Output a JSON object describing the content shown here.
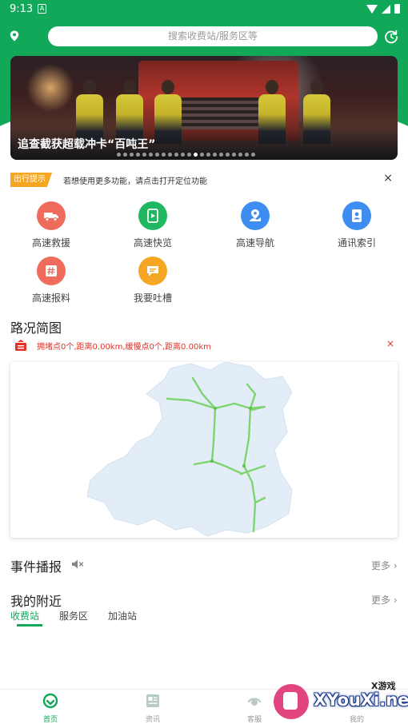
{
  "status_bar": {
    "time": "9:13",
    "notification_glyph": "A",
    "icons": [
      "wifi-icon",
      "signal-icon",
      "battery-icon"
    ]
  },
  "search": {
    "placeholder": "搜索收费站/服务区等"
  },
  "banner": {
    "caption": "追查截获超载冲卡“百吨王”",
    "dot_count": 22,
    "active_dot": 12
  },
  "tip": {
    "badge": "出行提示",
    "text": "若想使用更多功能，请点击打开定位功能",
    "close": "×"
  },
  "functions": [
    {
      "label": "高速救援",
      "icon": "tow-truck-icon",
      "color": "#ef6b5b"
    },
    {
      "label": "高速快览",
      "icon": "phone-video-icon",
      "color": "#1fb760"
    },
    {
      "label": "高速导航",
      "icon": "map-navigation-icon",
      "color": "#3d8ef0"
    },
    {
      "label": "通讯索引",
      "icon": "contacts-book-icon",
      "color": "#3d8ef0"
    },
    {
      "label": "高速报料",
      "icon": "hashtag-report-icon",
      "color": "#ef6b5b"
    },
    {
      "label": "我要吐槽",
      "icon": "chat-bubble-icon",
      "color": "#f5a623"
    }
  ],
  "road": {
    "title": "路况简图",
    "congestion_text": "拥堵点0个,距离0.00km,缓慢点0个,距离0.00km",
    "close": "×"
  },
  "events": {
    "title": "事件播报",
    "more": "更多"
  },
  "nearby": {
    "title": "我的附近",
    "more": "更多",
    "tabs": [
      "收费站",
      "服务区",
      "加油站"
    ],
    "active_tab": 0
  },
  "bottom_nav": [
    {
      "label": "首页",
      "icon": "home-icon",
      "active": true
    },
    {
      "label": "资讯",
      "icon": "news-icon",
      "active": false
    },
    {
      "label": "客服",
      "icon": "customer-service-icon",
      "active": false
    },
    {
      "label": "我的",
      "icon": "profile-icon",
      "active": false
    }
  ],
  "watermark": {
    "small": "X游戏",
    "big": "XYouXi.net"
  },
  "colors": {
    "brand_green": "#12a85a",
    "road_line": "#7ed56f",
    "alert_red": "#e0332a",
    "tip_orange": "#f5a623"
  }
}
